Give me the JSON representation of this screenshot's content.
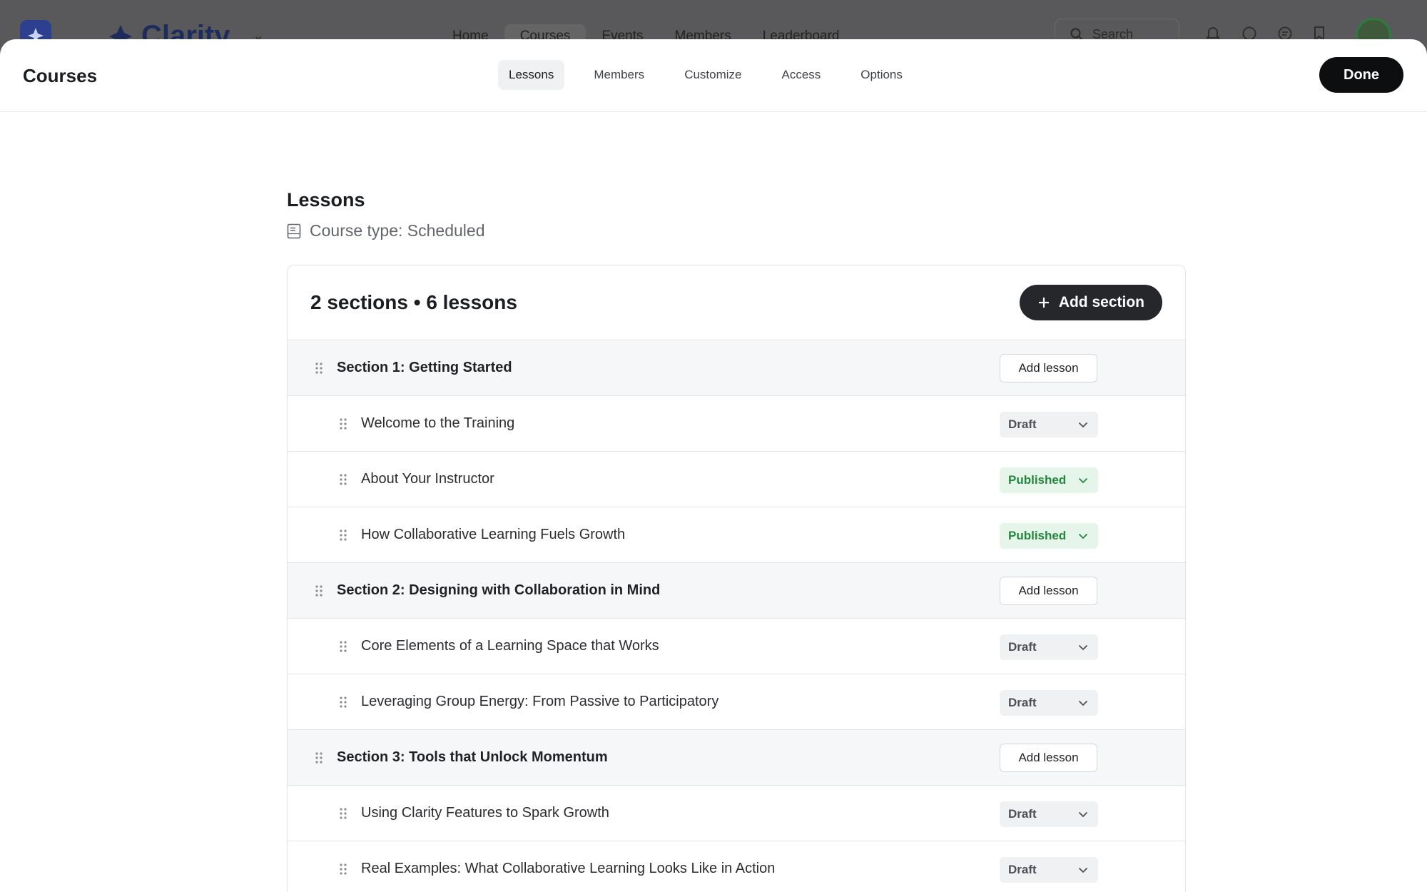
{
  "background": {
    "brand": "Clarity",
    "nav": [
      {
        "label": "Home",
        "active": false
      },
      {
        "label": "Courses",
        "active": true
      },
      {
        "label": "Events",
        "active": false
      },
      {
        "label": "Members",
        "active": false
      },
      {
        "label": "Leaderboard",
        "active": false
      }
    ],
    "search_placeholder": "Search",
    "icons": [
      "bell-icon",
      "chat-icon",
      "message-icon",
      "bookmark-icon"
    ]
  },
  "topbar": {
    "title": "Courses",
    "tabs": [
      {
        "label": "Lessons",
        "active": true
      },
      {
        "label": "Members",
        "active": false
      },
      {
        "label": "Customize",
        "active": false
      },
      {
        "label": "Access",
        "active": false
      },
      {
        "label": "Options",
        "active": false
      }
    ],
    "done_label": "Done"
  },
  "content": {
    "title": "Lessons",
    "course_type": "Course type: Scheduled",
    "summary": "2 sections • 6 lessons",
    "add_section_label": "Add section",
    "add_lesson_label": "Add lesson",
    "rows": [
      {
        "kind": "section",
        "label": "Section 1: Getting Started"
      },
      {
        "kind": "lesson",
        "label": "Welcome to the Training",
        "status": "Draft"
      },
      {
        "kind": "lesson",
        "label": "About Your Instructor",
        "status": "Published"
      },
      {
        "kind": "lesson",
        "label": "How Collaborative Learning Fuels Growth",
        "status": "Published"
      },
      {
        "kind": "section",
        "label": "Section 2: Designing with Collaboration in Mind"
      },
      {
        "kind": "lesson",
        "label": "Core Elements of a Learning Space that Works",
        "status": "Draft"
      },
      {
        "kind": "lesson",
        "label": "Leveraging Group Energy: From Passive to Participatory",
        "status": "Draft"
      },
      {
        "kind": "section",
        "label": "Section 3: Tools that Unlock Momentum"
      },
      {
        "kind": "lesson",
        "label": "Using Clarity Features to Spark Growth",
        "status": "Draft"
      },
      {
        "kind": "lesson",
        "label": "Real Examples: What Collaborative Learning Looks Like in Action",
        "status": "Draft"
      }
    ]
  },
  "colors": {
    "primary_dark": "#0d0e10",
    "published_text": "#24873e",
    "published_bg": "#e6f5e9",
    "draft_bg": "#f0f1f3",
    "brand_navy": "#2d3f8f"
  }
}
